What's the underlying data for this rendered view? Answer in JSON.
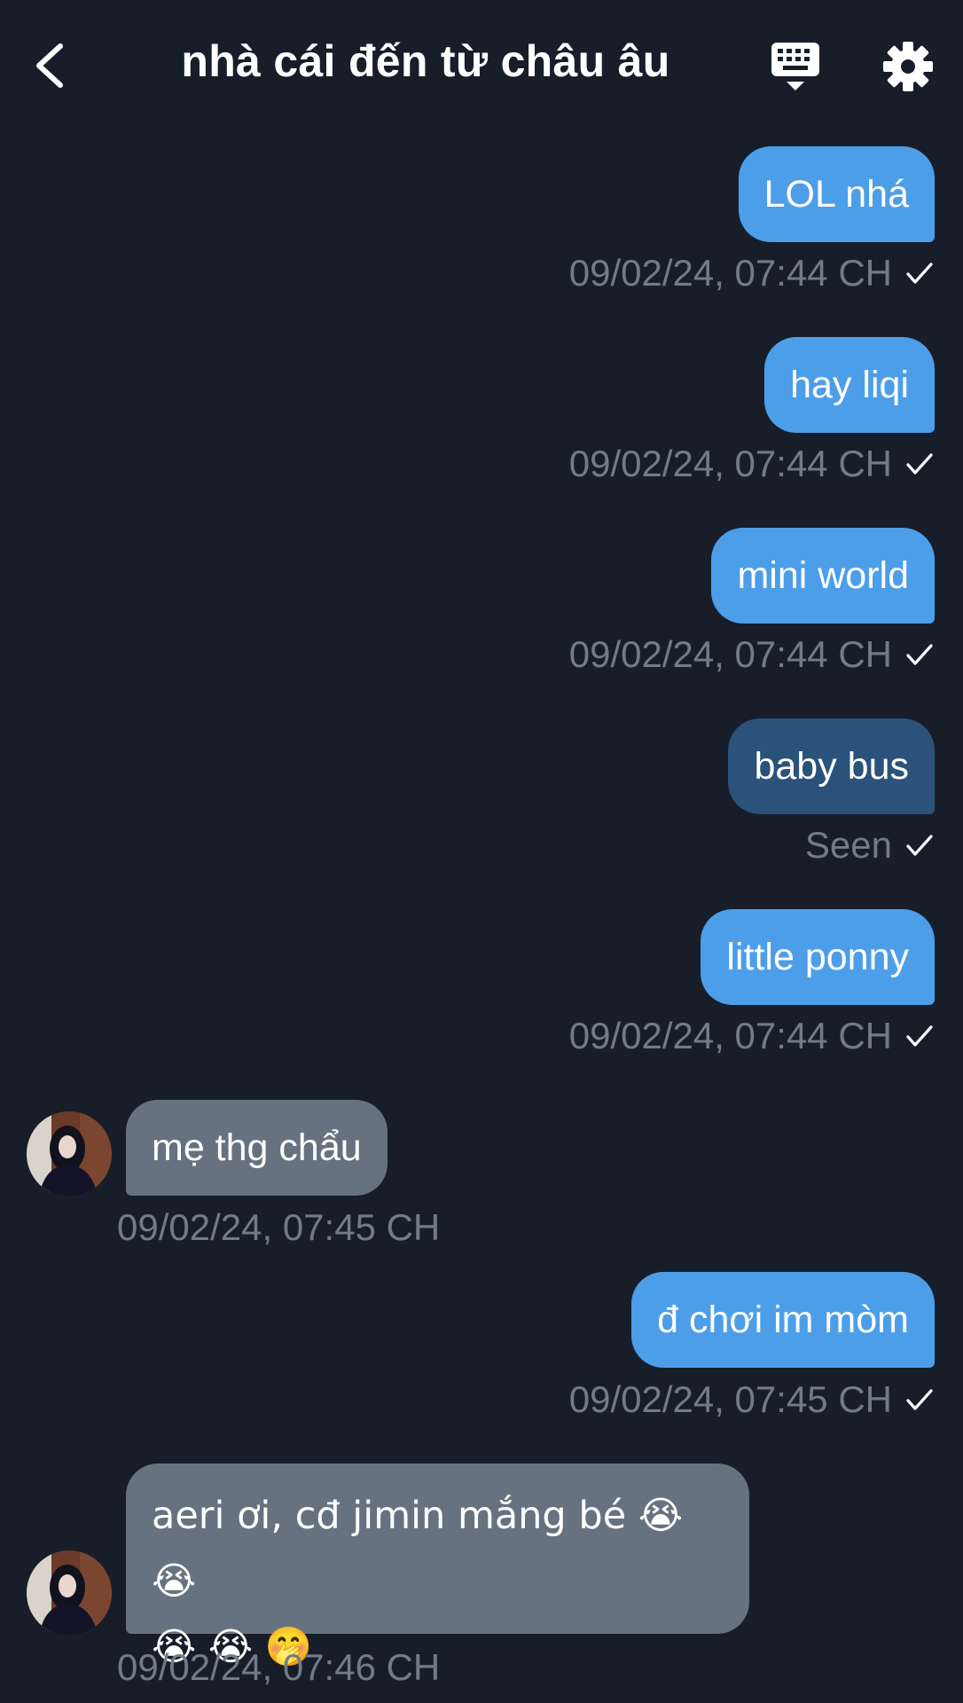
{
  "header": {
    "title": "nhà cái đến từ châu âu",
    "back_icon": "chevron-left-icon",
    "keyboard_icon": "keyboard-icon",
    "settings_icon": "gear-icon"
  },
  "colors": {
    "background": "#171e29",
    "outgoing_bubble": "#4d9ee9",
    "outgoing_seen_bubble": "#2a527a",
    "incoming_bubble": "#66727f",
    "meta_text": "#717c89"
  },
  "messages": [
    {
      "direction": "out",
      "text": "LOL nhá",
      "meta": "09/02/24, 07:44 CH"
    },
    {
      "direction": "out",
      "text": "hay liqi",
      "meta": "09/02/24, 07:44 CH"
    },
    {
      "direction": "out",
      "text": "mini world",
      "meta": "09/02/24, 07:44 CH"
    },
    {
      "direction": "out",
      "text": "baby bus",
      "meta": "Seen"
    },
    {
      "direction": "out",
      "text": "little ponny",
      "meta": "09/02/24, 07:44 CH"
    },
    {
      "direction": "in",
      "text": "mẹ thg chẩu",
      "meta": "09/02/24, 07:45 CH"
    },
    {
      "direction": "out",
      "text": "đ chơi im mòm",
      "meta": "09/02/24, 07:45 CH"
    },
    {
      "direction": "in",
      "text": "aeri ơi, cđ jimin mắng bé 😭 😭",
      "text_line2": "😭 😭 🤭",
      "meta": "09/02/24, 07:46 CH"
    }
  ]
}
